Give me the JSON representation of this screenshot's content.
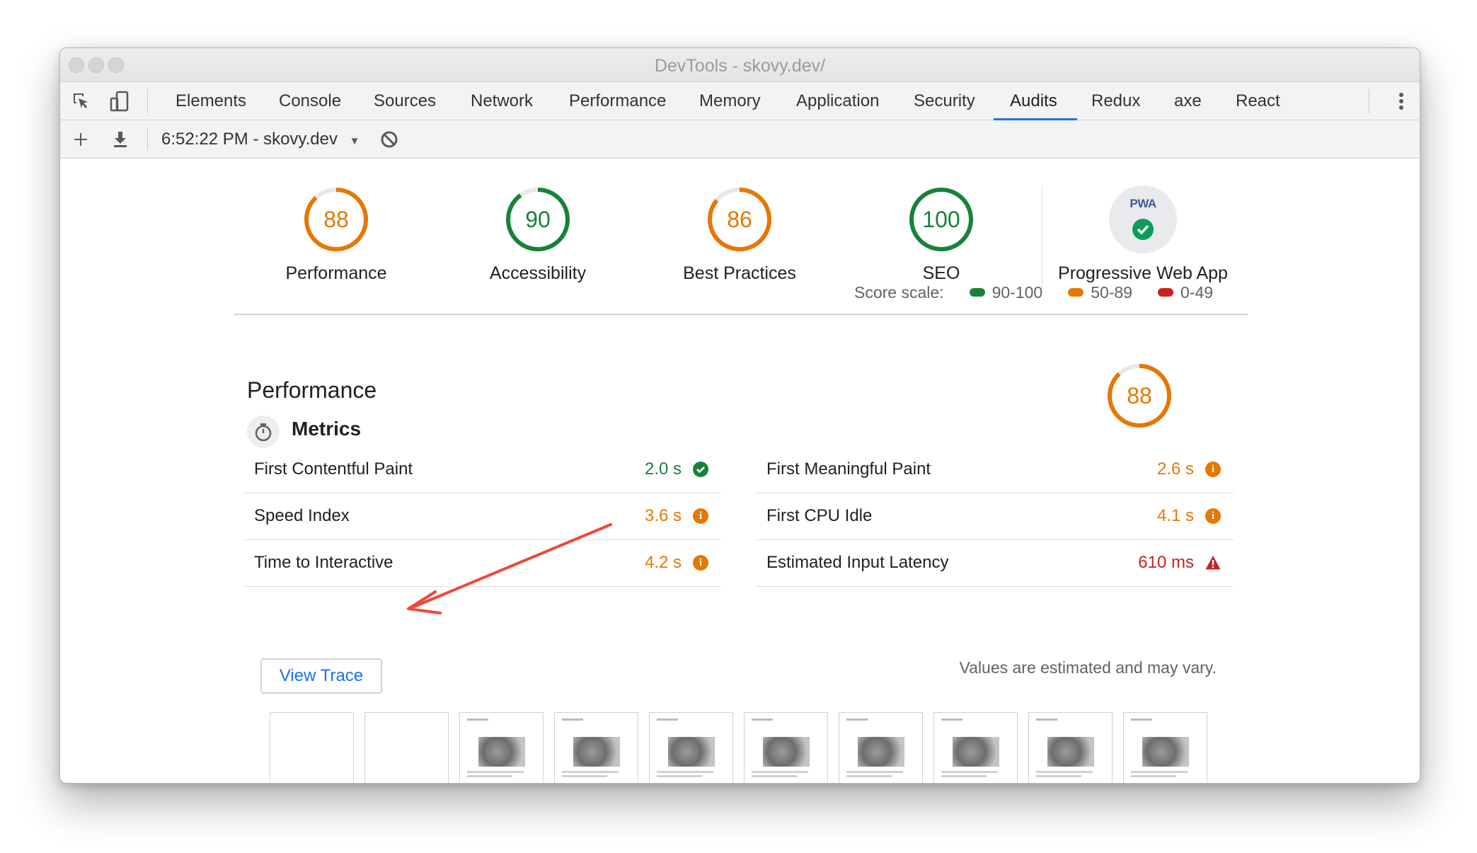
{
  "window": {
    "title": "DevTools - skovy.dev/"
  },
  "tabs": [
    "Elements",
    "Console",
    "Sources",
    "Network",
    "Performance",
    "Memory",
    "Application",
    "Security",
    "Audits",
    "Redux",
    "axe",
    "React"
  ],
  "active_tab": "Audits",
  "toolbar": {
    "session": "6:52:22 PM - skovy.dev"
  },
  "colors": {
    "pass": "#178239",
    "average": "#e67700",
    "fail": "#c7221f",
    "link": "#1a73e8"
  },
  "scores": [
    {
      "label": "Performance",
      "value": "88",
      "status": "average"
    },
    {
      "label": "Accessibility",
      "value": "90",
      "status": "pass"
    },
    {
      "label": "Best Practices",
      "value": "86",
      "status": "average"
    },
    {
      "label": "SEO",
      "value": "100",
      "status": "pass"
    }
  ],
  "pwa": {
    "badge": "PWA",
    "label": "Progressive Web App"
  },
  "score_scale": {
    "label": "Score scale:",
    "ranges": [
      "90-100",
      "50-89",
      "0-49"
    ]
  },
  "performance": {
    "title": "Performance",
    "score": "88",
    "metrics_title": "Metrics",
    "metrics": [
      {
        "name": "First Contentful Paint",
        "value": "2.0 s",
        "status": "pass"
      },
      {
        "name": "First Meaningful Paint",
        "value": "2.6 s",
        "status": "average"
      },
      {
        "name": "Speed Index",
        "value": "3.6 s",
        "status": "average"
      },
      {
        "name": "First CPU Idle",
        "value": "4.1 s",
        "status": "average"
      },
      {
        "name": "Time to Interactive",
        "value": "4.2 s",
        "status": "average"
      },
      {
        "name": "Estimated Input Latency",
        "value": "610 ms",
        "status": "fail"
      }
    ],
    "view_trace": "View Trace",
    "note": "Values are estimated and may vary."
  },
  "filmstrip_frames": 10
}
